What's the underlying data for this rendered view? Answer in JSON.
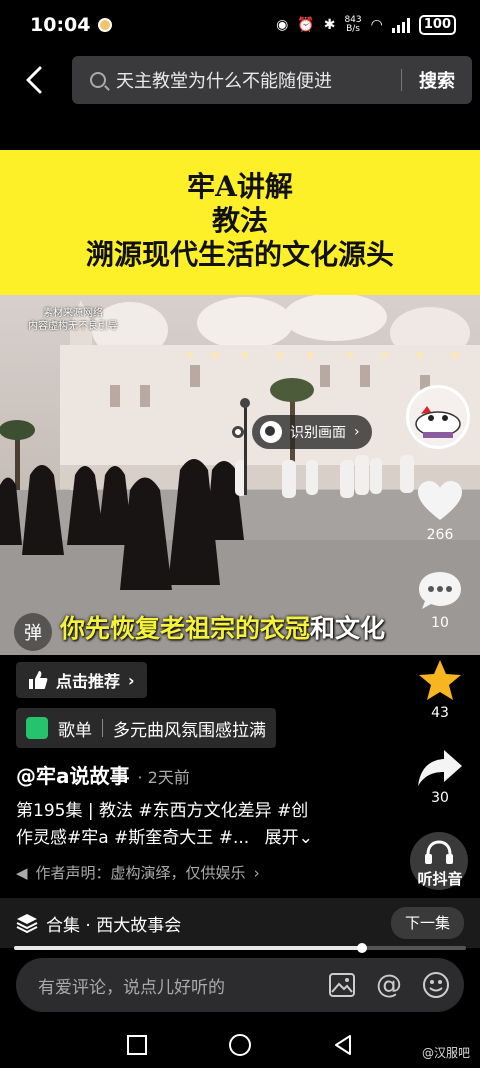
{
  "status_bar": {
    "time": "10:04",
    "net_speed_value": "843",
    "net_speed_unit": "B/s",
    "battery": "100"
  },
  "search": {
    "query": "天主教堂为什么不能随便进",
    "button": "搜索"
  },
  "banner": {
    "line1": "牢A讲解",
    "line2": "教法",
    "line3": "溯源现代生活的文化源头"
  },
  "video": {
    "credit_line1": "素材来源网络",
    "credit_line2": "内容虚构无不良引导",
    "recognize_label": "识别画面",
    "danmu_label": "弹",
    "subtitle_main": "你先恢复老祖宗的衣冠",
    "subtitle_end": "和文化"
  },
  "rail": {
    "likes": "266",
    "comments": "10",
    "favorites": "43",
    "shares": "30",
    "listen": "听抖音"
  },
  "info": {
    "recommend": "点击推荐",
    "playlist_tag": "歌单",
    "playlist_name": "多元曲风氛围感拉满",
    "author": "@牢a说故事",
    "posted": "· 2天前",
    "desc_line1": "第195集 | 教法 #东西方文化差异 #创",
    "desc_line2": "作灵感#牢a #斯奎奇大王 #...",
    "expand": "展开",
    "declaration": "作者声明：虚构演绎，仅供娱乐"
  },
  "collection": {
    "name": "合集 · 西大故事会",
    "next": "下一集",
    "progress": 0.77
  },
  "comment": {
    "placeholder": "有爱评论，说点儿好听的"
  },
  "watermark": "@汉服吧",
  "colors": {
    "banner_bg": "#fdf029",
    "subtitle": "#f5f23a",
    "star": "#f7b520"
  }
}
